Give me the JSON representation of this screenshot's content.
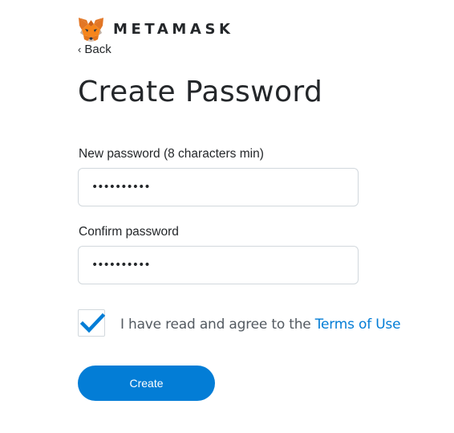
{
  "brand": {
    "name": "METAMASK",
    "logo_icon": "metamask-fox-icon"
  },
  "nav": {
    "back_label": "Back",
    "back_icon": "chevron-left-icon"
  },
  "page": {
    "title": "Create Password"
  },
  "form": {
    "new_password": {
      "label": "New password (8 characters min)",
      "value": "••••••••••"
    },
    "confirm_password": {
      "label": "Confirm password",
      "value": "••••••••••"
    },
    "terms": {
      "checked": true,
      "text": "I have read and agree to the ",
      "link_text": "Terms of Use"
    },
    "submit_label": "Create"
  },
  "colors": {
    "accent": "#037dd6",
    "text_primary": "#24272a",
    "text_secondary": "#535a61",
    "border": "#d2d8dd"
  }
}
